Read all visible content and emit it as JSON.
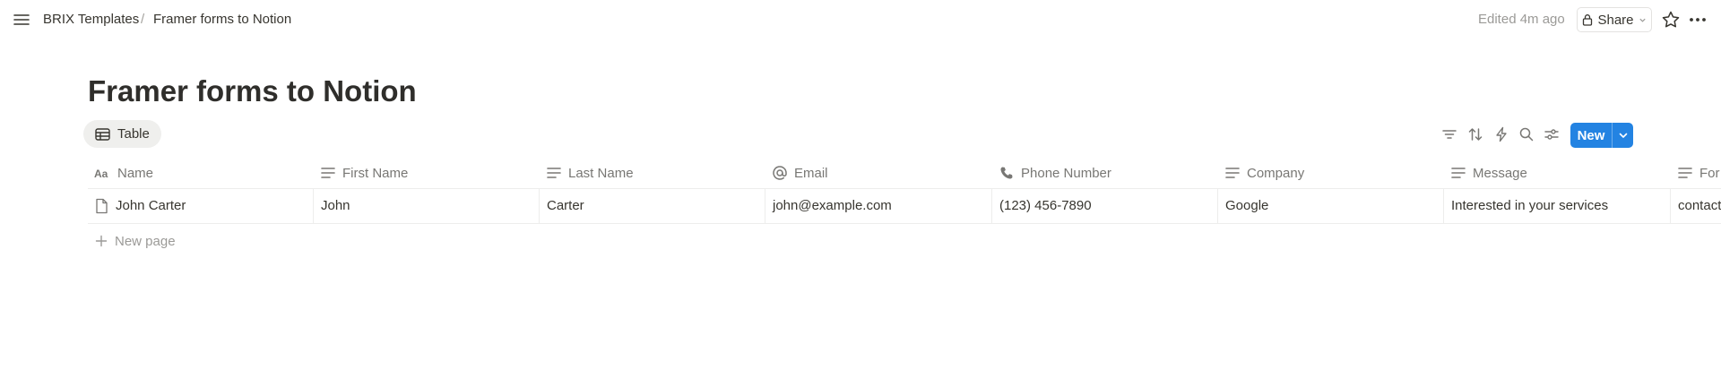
{
  "breadcrumb": {
    "workspace": "BRIX Templates",
    "separator": "/",
    "page": "Framer forms to Notion"
  },
  "header": {
    "edited": "Edited 4m ago",
    "share_label": "Share"
  },
  "page": {
    "title": "Framer forms to Notion"
  },
  "view": {
    "tab_label": "Table",
    "new_label": "New"
  },
  "table": {
    "columns": [
      "Name",
      "First Name",
      "Last Name",
      "Email",
      "Phone Number",
      "Company",
      "Message",
      "For"
    ],
    "rows": [
      {
        "name": "John Carter",
        "first_name": "John",
        "last_name": "Carter",
        "email": "john@example.com",
        "phone": "(123) 456-7890",
        "company": "Google",
        "message": "Interested in your services",
        "form": "contact"
      }
    ],
    "new_page_label": "New page"
  },
  "icons": {
    "menu": "hamburger-icon",
    "lock": "lock-icon",
    "star": "star-icon",
    "more": "more-horizontal-icon",
    "table": "table-icon",
    "filter": "filter-icon",
    "sort": "sort-icon",
    "automation": "lightning-icon",
    "search": "search-icon",
    "settings": "sliders-icon",
    "title_prop": "title-property-icon",
    "text_prop": "text-property-icon",
    "email_prop": "at-sign-icon",
    "phone_prop": "phone-icon",
    "page": "page-icon",
    "plus": "plus-icon"
  },
  "colors": {
    "accent": "#2383e2",
    "text": "#37352f",
    "muted": "#787774",
    "tab_bg": "#efefed"
  }
}
